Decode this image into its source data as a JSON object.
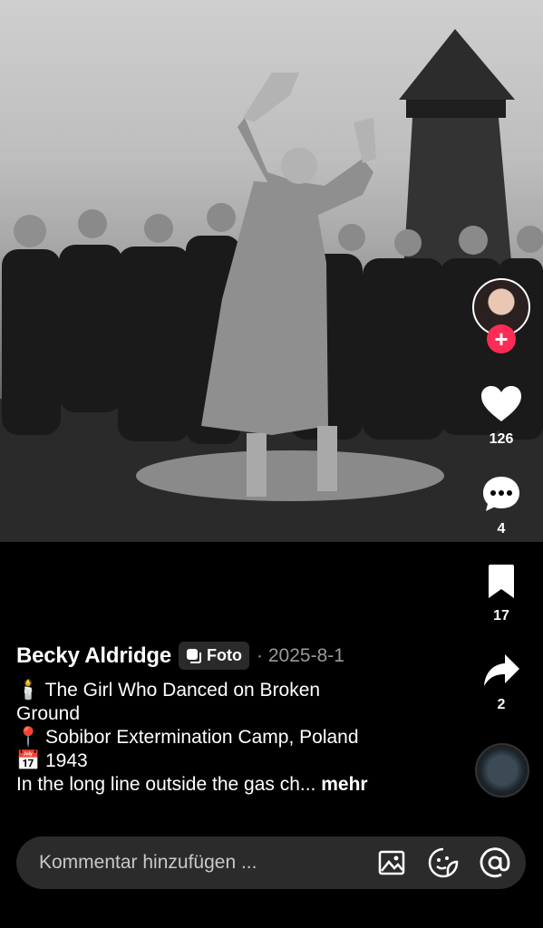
{
  "post": {
    "username": "Becky Aldridge",
    "badge_label": "Foto",
    "date": "· 2025-8-1",
    "caption": {
      "line1_icon": "candle-emoji",
      "line1": "The Girl Who Danced on Broken",
      "line1b": "Ground",
      "line2_icon": "pin-emoji",
      "line2": "Sobibor Extermination Camp, Poland",
      "line3_icon": "calendar-emoji",
      "line3": "1943",
      "line4": "In the long line outside the gas ch...",
      "more_label": "mehr"
    }
  },
  "actions": {
    "likes": "126",
    "comments": "4",
    "saves": "17",
    "shares": "2"
  },
  "comment_bar": {
    "placeholder": "Kommentar hinzufügen ..."
  },
  "colors": {
    "follow": "#fe2c55",
    "background": "#000000",
    "comment_bar": "#2b2b2b"
  }
}
